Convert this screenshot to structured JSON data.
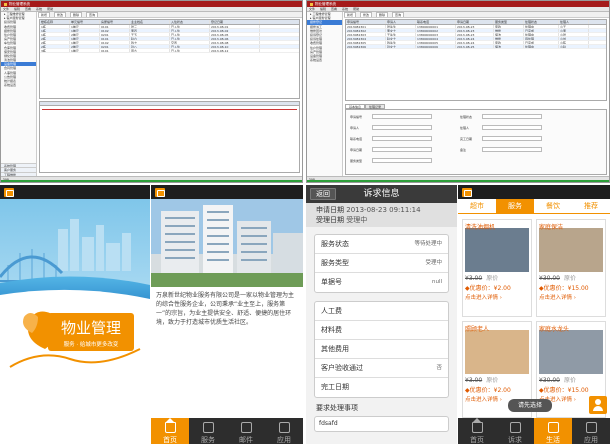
{
  "desktop_left": {
    "title": "物业管理系统",
    "menu": [
      "文件",
      "编辑",
      "查看",
      "系统",
      "帮助"
    ],
    "sidebar": [
      "工程维修管理",
      "客户服务管理",
      "投诉管理",
      "收费管理",
      "报修管理",
      "住户管理",
      "房产管理",
      "车位管理",
      "仓库管理",
      "保安管理",
      "绿化管理",
      "清洁管理",
      "设备管理",
      "合同管理",
      "人事管理",
      "公告管理",
      "统计报表",
      "系统设置"
    ],
    "sidebar_bottom": [
      "工程维修",
      "客户服务",
      "系统管理"
    ],
    "toolbar": [
      "新增",
      "修改",
      "删除",
      "查询"
    ],
    "columns": [
      "楼栋名称",
      "单元编号",
      "房屋编号",
      "业主姓名",
      "入住状态",
      "登记日期"
    ],
    "rows": [
      [
        "1栋",
        "1单元",
        "0101",
        "张三",
        "已入住",
        "2013-08-01"
      ],
      [
        "1栋",
        "1单元",
        "0102",
        "李四",
        "已入住",
        "2013-08-02"
      ],
      [
        "1栋",
        "2单元",
        "0201",
        "王五",
        "已入住",
        "2013-08-05"
      ],
      [
        "2栋",
        "1单元",
        "0101",
        "赵六",
        "已入住",
        "2013-08-06"
      ],
      [
        "2栋",
        "1单元",
        "0102",
        "钱七",
        "空置",
        "2013-08-08"
      ],
      [
        "2栋",
        "2单元",
        "0201",
        "孙八",
        "已入住",
        "2013-08-10"
      ],
      [
        "3栋",
        "1单元",
        "0101",
        "周九",
        "已入住",
        "2013-08-12"
      ]
    ],
    "status_text": "就绪"
  },
  "desktop_right": {
    "title": "物业管理系统",
    "menu": [
      "文件",
      "编辑",
      "查看",
      "系统",
      "帮助"
    ],
    "sidebar": [
      "工程维修管理",
      "客户服务管理",
      "报修登记",
      "报修派工",
      "维修回访",
      "投诉登记",
      "投诉处理",
      "收费管理",
      "住户管理",
      "房产管理",
      "设备管理",
      "系统设置"
    ],
    "toolbar": [
      "新增",
      "修改",
      "删除",
      "查询"
    ],
    "columns": [
      "申请编号",
      "申请人",
      "联系电话",
      "申请日期",
      "服务类型",
      "处理状态",
      "处理人"
    ],
    "rows": [
      [
        "2013082301",
        "张先生",
        "13800000001",
        "2013-08-23",
        "家政",
        "处理中",
        "小王"
      ],
      [
        "2013082302",
        "李女士",
        "13800000002",
        "2013-08-23",
        "维修",
        "已完成",
        "小李"
      ],
      [
        "2013082303",
        "王先生",
        "13800000003",
        "2013-08-23",
        "保洁",
        "处理中",
        "小张"
      ],
      [
        "2013082304",
        "赵女士",
        "13800000004",
        "2013-08-24",
        "维修",
        "待处理",
        "小刘"
      ],
      [
        "2013082305",
        "钱先生",
        "13800000005",
        "2013-08-24",
        "家政",
        "已完成",
        "小陈"
      ],
      [
        "2013082306",
        "孙女士",
        "13800000006",
        "2013-08-25",
        "保洁",
        "处理中",
        "小赵"
      ]
    ],
    "detail_tabs": [
      "基本信息",
      "处理记录"
    ],
    "form_labels": [
      "申请编号",
      "申请人",
      "联系电话",
      "申请日期",
      "服务类型",
      "处理状态",
      "处理人",
      "完工日期",
      "备注"
    ],
    "status_text": "就绪"
  },
  "phone1": {
    "brand_title": "物业管理",
    "brand_sub": "服务 · 给城市更多改变"
  },
  "phone2": {
    "intro": "万泉新世纪物业服务有限公司是一家以物业管理为主的综合性服务企业，公司秉承“业主至上，服务第一”的宗旨，为业主提供安全、舒适、便捷的居住环境，致力于打造城市优质生活社区。",
    "tabs": [
      {
        "label": "首页",
        "icon": "home-icon",
        "active": true
      },
      {
        "label": "服务",
        "icon": "service-icon",
        "active": false
      },
      {
        "label": "邮件",
        "icon": "mail-icon",
        "active": false
      },
      {
        "label": "应用",
        "icon": "apps-icon",
        "active": false
      }
    ]
  },
  "phone3": {
    "back_label": "返回",
    "header_title": "诉求信息",
    "apply_date_label": "申请日期",
    "apply_date": "2013-08-23 09:11:14",
    "accept_date_label": "受理日期",
    "accept_date": "受理中",
    "rows": [
      {
        "label": "服务状态",
        "value": "等待处理中"
      },
      {
        "label": "服务类型",
        "value": "受理中"
      },
      {
        "label": "单据号",
        "value": "null"
      }
    ],
    "rows2": [
      {
        "label": "人工费",
        "value": ""
      },
      {
        "label": "材料费",
        "value": ""
      },
      {
        "label": "其他费用",
        "value": ""
      },
      {
        "label": "客户验收通过",
        "value": "否"
      },
      {
        "label": "完工日期",
        "value": ""
      }
    ],
    "desc_label": "要求处理事项",
    "desc_value": "fdsafd"
  },
  "phone4": {
    "tabs": [
      "超市",
      "服务",
      "餐饮",
      "推荐"
    ],
    "active_tab": "服务",
    "cards": [
      {
        "title": "清洗油烟机",
        "orig": "¥3.00",
        "price": "¥2.00",
        "link": "点击进入详情"
      },
      {
        "title": "家庭保洁",
        "orig": "¥30.00",
        "price": "¥15.00",
        "link": "点击进入详情"
      },
      {
        "title": "照顾老人",
        "orig": "¥3.00",
        "price": "¥2.00",
        "link": "点击进入详情"
      },
      {
        "title": "家庭水龙头",
        "orig": "¥30.00",
        "price": "¥15.00",
        "link": "点击进入详情"
      }
    ],
    "orig_label": "原价",
    "price_label": "优惠价：",
    "popup": "请先选择",
    "tab_labels": [
      "首页",
      "诉求",
      "生活",
      "应用"
    ],
    "active_bottom": "生活"
  }
}
